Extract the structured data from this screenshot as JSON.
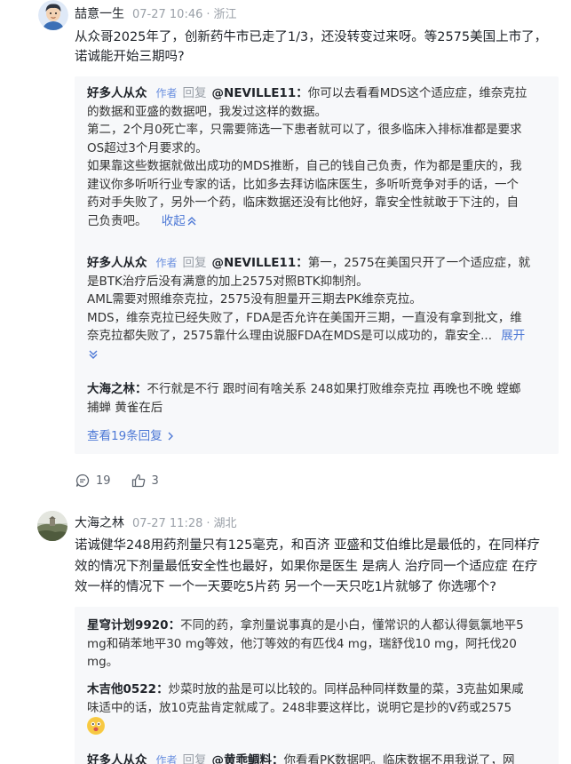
{
  "comments": [
    {
      "user": "喆意一生",
      "time": "07-27 10:46",
      "sep": "·",
      "location": "浙江",
      "lines": [
        "从众哥2025年了，创新药牛市已走了1/3，还没转变过来呀。等2575美国上市了，",
        "诺诚能开始三期吗?"
      ],
      "replies": [
        {
          "user": "好多人从众",
          "tag": "作者",
          "reply_word": "回复",
          "target": "@NEVILLE11：",
          "first_line": "你可以去看看MDS这个适应症，维奈克拉",
          "lines": [
            "的数据和亚盛的数据吧，我发过这样的数据。",
            "第二，2个月0死亡率，只需要筛选一下患者就可以了，很多临床入排标准都是要求",
            "OS超过3个月要求的。",
            "如果靠这些数据就做出成功的MDS推断，自己的钱自己负责，作为都是重庆的，我",
            "建议你多听听行业专家的话，比如多去拜访临床医生，多听听竞争对手的话，一个",
            "药对手失败了，另外一个药，临床数据还没有比他好，靠安全性就敢于下注的，自"
          ],
          "last_line": "己负责吧。",
          "toggle": "收起"
        },
        {
          "user": "好多人从众",
          "tag": "作者",
          "reply_word": "回复",
          "target": "@NEVILLE11：",
          "first_line": "第一，2575在美国只开了一个适应症，就",
          "lines": [
            "是BTK治疗后没有满意的加上2575对照BTK抑制剂。",
            "AML需要对照维奈克拉，2575没有胆量开三期去PK维奈克拉。",
            "MDS，维奈克拉已经失败了，FDA是否允许在美国开三期，一直没有拿到批文，维",
            "奈克拉都失败了，2575靠什么理由说服FDA在MDS是可以成功的，靠安全..."
          ],
          "toggle": "展开"
        },
        {
          "user": "大海之林",
          "colon": "：",
          "first_line": "不行就是不行 跟时间有啥关系 248如果打败维奈克拉 再晚也不晚 螳螂",
          "last_line": "捕蝉 黄雀在后"
        }
      ],
      "view_more": "查看19条回复",
      "comment_count": "19",
      "like_count": "3"
    },
    {
      "user": "大海之林",
      "time": "07-27 11:28",
      "sep": "·",
      "location": "湖北",
      "lines": [
        "诺诚健华248用药剂量只有125毫克，和百济 亚盛和艾伯维比是最低的，在同样疗",
        "效的情况下剂量最低安全性也最好，如果你是医生 是病人 治疗同一个适应症 在疗",
        "效一样的情况下 一个一天要吃5片药 另一个一天只吃1片就够了 你选哪个?"
      ],
      "replies": [
        {
          "user": "星穹计划9920",
          "colon": "：",
          "first_line": "不同的药，拿剂量说事真的是小白，懂常识的人都认得氨氯地平5",
          "lines": [
            "mg和硝苯地平30 mg等效，他汀等效的有匹伐4 mg，瑞舒伐10 mg，阿托伐20",
            "mg。"
          ]
        },
        {
          "user": "木吉他0522",
          "colon": "：",
          "first_line": "炒菜时放的盐是可以比较的。同样品种同样数量的菜，3克盐如果咸",
          "lines": [
            "味适中的话，放10克盐肯定就咸了。248非要这样比，说明它是抄的V药或2575"
          ]
        },
        {
          "user": "好多人从众",
          "tag": "作者",
          "reply_word": "回复",
          "target": "@黄乖鲷料：",
          "first_line": "你看看PK数据吧。临床数据不用我说了，网"
        }
      ]
    }
  ]
}
